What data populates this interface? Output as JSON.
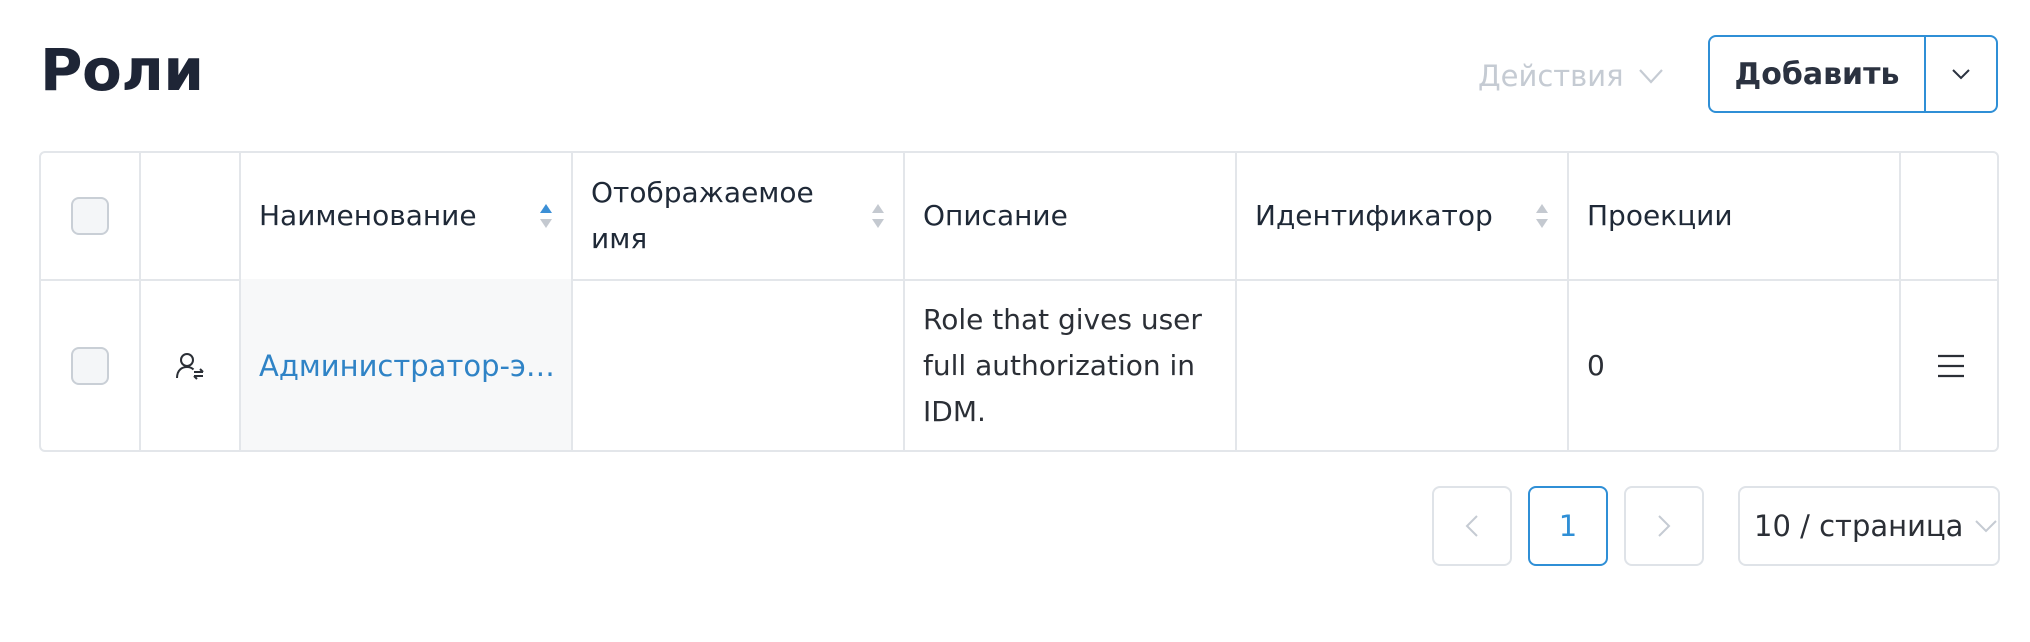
{
  "page": {
    "title": "Роли"
  },
  "toolbar": {
    "actions_label": "Действия",
    "add_label": "Добавить"
  },
  "table": {
    "columns": [
      {
        "label": "Наименование",
        "sortable": true,
        "sort": "ascending"
      },
      {
        "label": "Отображаемое имя",
        "sortable": true
      },
      {
        "label": "Описание",
        "sortable": false
      },
      {
        "label": "Идентификатор",
        "sortable": true
      },
      {
        "label": "Проекции",
        "sortable": false
      }
    ],
    "rows": [
      {
        "icon": "user-role-icon",
        "name": "Администратор-эк…",
        "display_name": "",
        "description": "Role that gives user full authorization in IDM.",
        "identifier": "",
        "projections": "0"
      }
    ]
  },
  "pagination": {
    "current_page": "1",
    "page_size": "10 / страница"
  },
  "colors": {
    "accent": "#2f8fd6",
    "link": "#2f83c6",
    "sort_active": "#3b8fd6",
    "sort_inactive": "#c4c9d0",
    "disabled_text": "#c5cbd3",
    "border": "#e3e6ea"
  },
  "icons": {
    "actions": "chevron-down-icon",
    "add_toggle": "chevron-down-icon",
    "row_menu": "menu-icon",
    "prev": "chevron-left-icon",
    "next": "chevron-right-icon",
    "page_size": "chevron-down-icon"
  }
}
